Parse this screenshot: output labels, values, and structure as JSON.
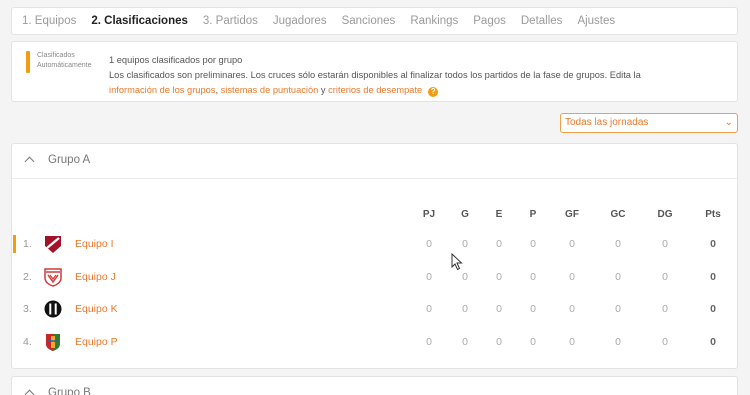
{
  "tabs": [
    {
      "label": "1. Equipos",
      "active": false
    },
    {
      "label": "2. Clasificaciones",
      "active": true
    },
    {
      "label": "3. Partidos",
      "active": false
    },
    {
      "label": "Jugadores",
      "active": false
    },
    {
      "label": "Sanciones",
      "active": false
    },
    {
      "label": "Rankings",
      "active": false
    },
    {
      "label": "Pagos",
      "active": false
    },
    {
      "label": "Detalles",
      "active": false
    },
    {
      "label": "Ajustes",
      "active": false
    }
  ],
  "info": {
    "caption_line1": "Clasificados",
    "caption_line2": "Automáticamente",
    "line1": "1 equipos clasificados por grupo",
    "line2": "Los clasificados son preliminares. Los cruces sólo estarán disponibles al finalizar todos los partidos de la fase de grupos. Edita la",
    "link_groups": "información de los grupos",
    "sep1": ", ",
    "link_scoring": "sistemas de puntuación",
    "sep2": " y ",
    "link_tiebreak": "criterios de desempate",
    "help_glyph": "?"
  },
  "filter": {
    "selected": "Todas las jornadas",
    "chevron": "⌄"
  },
  "group_a": {
    "title": "Grupo A",
    "columns": [
      "PJ",
      "G",
      "E",
      "P",
      "GF",
      "GC",
      "DG",
      "Pts"
    ],
    "rows": [
      {
        "pos": "1.",
        "team": "Equipo I",
        "crest": "crest-red-diagonal",
        "stats": [
          "0",
          "0",
          "0",
          "0",
          "0",
          "0",
          "0",
          "0"
        ],
        "qualified": true
      },
      {
        "pos": "2.",
        "team": "Equipo J",
        "crest": "crest-red-white-shield",
        "stats": [
          "0",
          "0",
          "0",
          "0",
          "0",
          "0",
          "0",
          "0"
        ],
        "qualified": false
      },
      {
        "pos": "3.",
        "team": "Equipo K",
        "crest": "crest-black-stripes",
        "stats": [
          "0",
          "0",
          "0",
          "0",
          "0",
          "0",
          "0",
          "0"
        ],
        "qualified": false
      },
      {
        "pos": "4.",
        "team": "Equipo P",
        "crest": "crest-multicolor-shield",
        "stats": [
          "0",
          "0",
          "0",
          "0",
          "0",
          "0",
          "0",
          "0"
        ],
        "qualified": false
      }
    ]
  },
  "group_b": {
    "title": "Grupo B"
  },
  "colors": {
    "accent": "#e8792d",
    "indicator": "#f39c12"
  }
}
